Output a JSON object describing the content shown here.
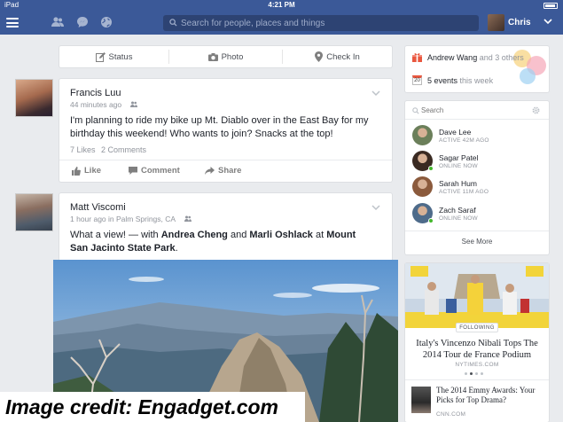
{
  "statusbar": {
    "carrier": "iPad",
    "time": "4:21 PM"
  },
  "header": {
    "search_placeholder": "Search for people, places and things",
    "user_name": "Chris"
  },
  "composer": {
    "status": "Status",
    "photo": "Photo",
    "checkin": "Check In"
  },
  "posts": [
    {
      "author": "Francis Luu",
      "meta": "44 minutes ago",
      "text": "I'm planning to ride my bike up Mt. Diablo over in the East Bay for my birthday this weekend! Who wants to join? Snacks at the top!",
      "likes": "7 Likes",
      "comments": "2 Comments",
      "actions": {
        "like": "Like",
        "comment": "Comment",
        "share": "Share"
      }
    },
    {
      "author": "Matt Viscomi",
      "meta": "1 hour ago in Palm Springs, CA",
      "text_prefix": "What a view! — with",
      "tag1": "Andrea Cheng",
      "and": "and",
      "tag2": "Marli Oshlack",
      "at": "at",
      "place": "Mount San Jacinto State Park",
      "text_suffix": "."
    }
  ],
  "sidebar": {
    "birthday": {
      "name": "Andrew Wang",
      "rest": "and 3 others"
    },
    "events": {
      "date": "20",
      "bold": "5 events",
      "rest": "this week"
    },
    "chat": {
      "search_placeholder": "Search",
      "contacts": [
        {
          "name": "Dave Lee",
          "status": "ACTIVE 42M AGO",
          "online": false,
          "color": "#6b7f5a"
        },
        {
          "name": "Sagar Patel",
          "status": "ONLINE NOW",
          "online": true,
          "color": "#3a2a22"
        },
        {
          "name": "Sarah Hum",
          "status": "ACTIVE 11M AGO",
          "online": false,
          "color": "#8b5a3c"
        },
        {
          "name": "Zach Saraf",
          "status": "ONLINE NOW",
          "online": true,
          "color": "#4e6b8a"
        }
      ],
      "see_more": "See More"
    },
    "trending": {
      "badge": "FOLLOWING",
      "headline": "Italy's Vincenzo Nibali Tops The 2014 Tour de France Podium",
      "source": "NYTIMES.COM",
      "headline2": "The 2014 Emmy Awards: Your Picks for Top Drama?",
      "source2": "CNN.COM"
    }
  },
  "credit": "Image credit: Engadget.com",
  "colors": {
    "brand": "#3b5998",
    "link": "#365899",
    "background": "#e9ebee"
  }
}
